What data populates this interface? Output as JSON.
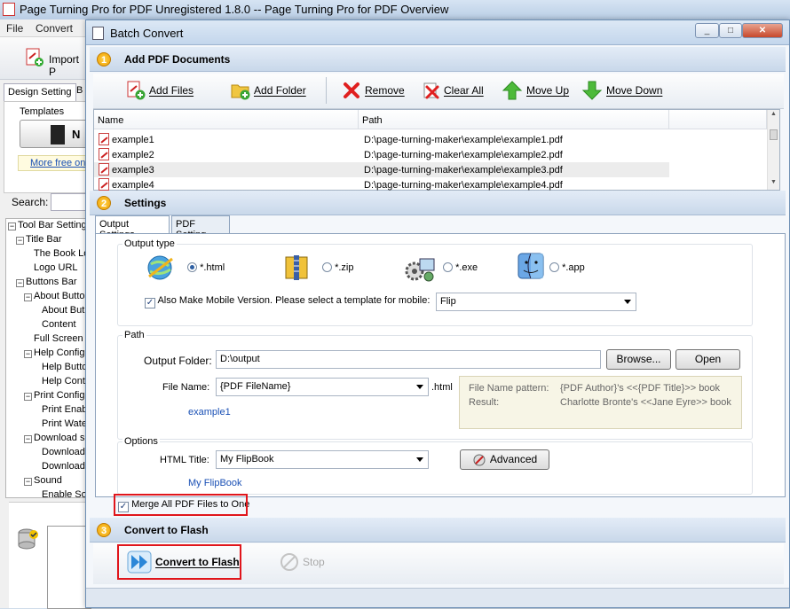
{
  "main_window": {
    "title": "Page Turning Pro for PDF Unregistered 1.8.0  -- Page Turning Pro for PDF Overview",
    "menu": [
      "File",
      "Convert"
    ],
    "import_button": "Import P",
    "tabs": [
      "Design Setting",
      "B"
    ],
    "templates_label": "Templates",
    "template_btn": "N",
    "more_free_link": "More free on",
    "search_label": "Search:",
    "tree": [
      {
        "label": "Tool Bar Setting",
        "level": 0,
        "expander": "−"
      },
      {
        "label": "Title Bar",
        "level": 1,
        "expander": "−"
      },
      {
        "label": "The Book Lo",
        "level": 2
      },
      {
        "label": "Logo URL",
        "level": 2
      },
      {
        "label": "Buttons Bar",
        "level": 1,
        "expander": "−"
      },
      {
        "label": "About Butto",
        "level": 2,
        "expander": "−"
      },
      {
        "label": "About But",
        "level": 3
      },
      {
        "label": "Content",
        "level": 3
      },
      {
        "label": "Full Screen",
        "level": 2
      },
      {
        "label": "Help Config",
        "level": 2,
        "expander": "−"
      },
      {
        "label": "Help Butto",
        "level": 3
      },
      {
        "label": "Help Cont",
        "level": 3
      },
      {
        "label": "Print Config",
        "level": 2,
        "expander": "−"
      },
      {
        "label": "Print Enab",
        "level": 3
      },
      {
        "label": "Print Wate",
        "level": 3
      },
      {
        "label": "Download se",
        "level": 2,
        "expander": "−"
      },
      {
        "label": "Download",
        "level": 3
      },
      {
        "label": "Download",
        "level": 3
      },
      {
        "label": "Sound",
        "level": 2,
        "expander": "−"
      },
      {
        "label": "Enable So",
        "level": 3
      }
    ]
  },
  "dialog": {
    "title": "Batch Convert",
    "window_buttons": [
      "_",
      "□",
      "✕"
    ],
    "section1": {
      "num": "1",
      "title": "Add PDF Documents"
    },
    "toolbar": {
      "add_files": "Add Files",
      "add_folder": "Add Folder",
      "remove": "Remove",
      "clear_all": "Clear All",
      "move_up": "Move Up",
      "move_down": "Move Down"
    },
    "file_list": {
      "columns": [
        "Name",
        "Path"
      ],
      "rows": [
        {
          "name": "example1",
          "path": "D:\\page-turning-maker\\example\\example1.pdf"
        },
        {
          "name": "example2",
          "path": "D:\\page-turning-maker\\example\\example2.pdf"
        },
        {
          "name": "example3",
          "path": "D:\\page-turning-maker\\example\\example3.pdf"
        },
        {
          "name": "example4",
          "path": "D:\\page-turning-maker\\example\\example4.pdf"
        }
      ]
    },
    "section2": {
      "num": "2",
      "title": "Settings"
    },
    "settings_tabs": [
      "Output Settings",
      "PDF Setting"
    ],
    "output_type": {
      "label": "Output type",
      "options": [
        "*.html",
        "*.zip",
        "*.exe",
        "*.app"
      ],
      "selected": "*.html",
      "mobile_label": "Also Make Mobile Version. Please select a template for mobile:",
      "mobile_template": "Flip"
    },
    "path": {
      "label": "Path",
      "output_folder_label": "Output Folder:",
      "output_folder": "D:\\output",
      "browse": "Browse...",
      "open": "Open",
      "file_name_label": "File Name:",
      "file_name": "{PDF FileName}",
      "file_ext": ".html",
      "file_name_preview": "example1",
      "pattern_label": "File Name pattern:",
      "pattern_value": "{PDF Author}'s <<{PDF Title}>> book",
      "result_label": "Result:",
      "result_value": "Charlotte Bronte's <<Jane Eyre>> book"
    },
    "options": {
      "label": "Options",
      "html_title_label": "HTML Title:",
      "html_title": "My FlipBook",
      "html_title_preview": "My FlipBook",
      "advanced": "Advanced"
    },
    "merge_label": "Merge All PDF Files to One",
    "section3": {
      "num": "3",
      "title": "Convert to Flash"
    },
    "convert_button": "Convert to Flash",
    "stop_button": "Stop"
  }
}
